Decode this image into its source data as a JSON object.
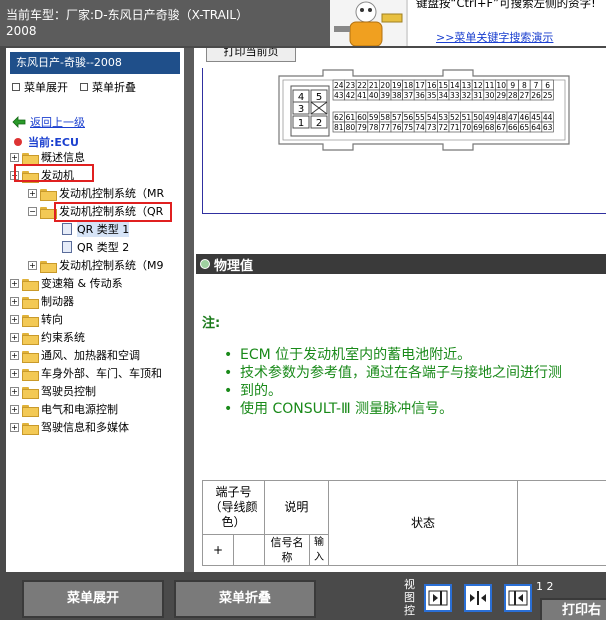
{
  "header": {
    "vehicle_line1": "当前车型：厂家:D-东风日产奇骏（X-TRAIL）",
    "vehicle_line2": "2008",
    "hint_text": "键盘按“Ctrl+F”可搜索左侧的资字!",
    "hint_link": ">>菜单关键字搜索演示"
  },
  "sidebar": {
    "title": "东风日产-奇骏--2008",
    "expand_label": "菜单展开",
    "collapse_label": "菜单折叠",
    "back_label": "返回上一级",
    "current_label": "当前:ECU",
    "tree": [
      {
        "label": "概述信息",
        "level": 0,
        "sign": "+"
      },
      {
        "label": "发动机",
        "level": 0,
        "sign": "−"
      },
      {
        "label": "发动机控制系统（MR",
        "level": 1,
        "sign": "+"
      },
      {
        "label": "发动机控制系统（QR",
        "level": 1,
        "sign": "−"
      },
      {
        "label": "QR 类型 1",
        "level": 2,
        "sign": ""
      },
      {
        "label": "QR 类型 2",
        "level": 2,
        "sign": ""
      },
      {
        "label": "发动机控制系统（M9",
        "level": 1,
        "sign": "+"
      },
      {
        "label": "变速箱 & 传动系",
        "level": 0,
        "sign": "+"
      },
      {
        "label": "制动器",
        "level": 0,
        "sign": "+"
      },
      {
        "label": "转向",
        "level": 0,
        "sign": "+"
      },
      {
        "label": "约束系统",
        "level": 0,
        "sign": "+"
      },
      {
        "label": "通风、加热器和空调",
        "level": 0,
        "sign": "+"
      },
      {
        "label": "车身外部、车门、车顶和",
        "level": 0,
        "sign": "+"
      },
      {
        "label": "驾驶员控制",
        "level": 0,
        "sign": "+"
      },
      {
        "label": "电气和电源控制",
        "level": 0,
        "sign": "+"
      },
      {
        "label": "驾驶信息和多媒体",
        "level": 0,
        "sign": "+"
      }
    ]
  },
  "content": {
    "print_button": "打印当前页",
    "connector_pins_top_row1": [
      "24",
      "23",
      "22",
      "21",
      "20",
      "19",
      "18",
      "17",
      "16",
      "15",
      "14",
      "13",
      "12",
      "11",
      "10",
      "9",
      "8",
      "7",
      "6"
    ],
    "connector_pins_top_row2": [
      "43",
      "42",
      "41",
      "40",
      "39",
      "38",
      "37",
      "36",
      "35",
      "34",
      "33",
      "32",
      "31",
      "30",
      "29",
      "28",
      "27",
      "26",
      "25"
    ],
    "connector_pins_bottom_row1": [
      "62",
      "61",
      "60",
      "59",
      "58",
      "57",
      "56",
      "55",
      "54",
      "53",
      "52",
      "51",
      "50",
      "49",
      "48",
      "47",
      "46",
      "45",
      "44"
    ],
    "connector_pins_bottom_row2": [
      "81",
      "80",
      "79",
      "78",
      "77",
      "76",
      "75",
      "74",
      "73",
      "72",
      "71",
      "70",
      "69",
      "68",
      "67",
      "66",
      "65",
      "64",
      "63"
    ],
    "small_connector": [
      "4",
      "5",
      "3",
      "1",
      "2"
    ],
    "section_title": "物理值",
    "note_title": "注:",
    "notes": [
      "ECM 位于发动机室内的蓄电池附近。",
      "技术参数为参考值，通过在各端子与接地之间进行测",
      "到的。",
      "使用 CONSULT-Ⅲ 测量脉冲信号。"
    ],
    "table": {
      "col_terminal": "端子号（导线颜色）",
      "col_desc": "说明",
      "col_state": "状态",
      "plus": "+",
      "signal_name": "信号名称",
      "io": "输入"
    }
  },
  "bottom": {
    "expand_button": "菜单展开",
    "collapse_button": "菜单折叠",
    "view_label": "视图控",
    "page_indicator": "1 2",
    "print_button": "打印右"
  }
}
